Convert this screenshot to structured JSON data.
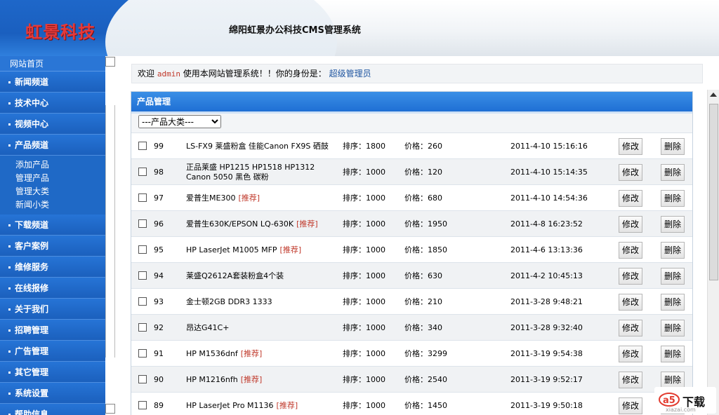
{
  "header": {
    "logo": "虹景科技",
    "system_title": "绵阳虹景办公科技CMS管理系统"
  },
  "sidebar": {
    "home": "网站首页",
    "items": [
      {
        "label": "新闻频道"
      },
      {
        "label": "技术中心"
      },
      {
        "label": "视频中心"
      },
      {
        "label": "产品频道",
        "sub": [
          "添加产品",
          "管理产品",
          "管理大类",
          "新闻小类"
        ]
      },
      {
        "label": "下载频道"
      },
      {
        "label": "客户案例"
      },
      {
        "label": "维修服务"
      },
      {
        "label": "在线报修"
      },
      {
        "label": "关于我们"
      },
      {
        "label": "招聘管理"
      },
      {
        "label": "广告管理"
      },
      {
        "label": "其它管理"
      },
      {
        "label": "系统设置"
      },
      {
        "label": "帮助信息"
      }
    ]
  },
  "welcome": {
    "prefix": "欢迎",
    "username": "admin",
    "middle": "使用本网站管理系统！！你的身份是：",
    "role": "超级管理员"
  },
  "panel": {
    "title": "产品管理",
    "filter_selected": "---产品大类---",
    "edit_label": "修改",
    "delete_label": "删除",
    "rows": [
      {
        "id": "99",
        "name": "LS-FX9 莱盛粉盒 佳能Canon FX9S 硒鼓",
        "tag": "",
        "sort": "排序：1800",
        "price": "价格：260",
        "date": "2011-4-10 15:16:16"
      },
      {
        "id": "98",
        "name": "正品莱盛 HP1215 HP1518 HP1312 Canon 5050 黑色 碳粉",
        "tag": "",
        "sort": "排序：1000",
        "price": "价格：120",
        "date": "2011-4-10 15:14:35"
      },
      {
        "id": "97",
        "name": "爱普生ME300",
        "tag": "[推荐]",
        "sort": "排序：1000",
        "price": "价格：680",
        "date": "2011-4-10 14:54:36"
      },
      {
        "id": "96",
        "name": "爱普生630K/EPSON LQ-630K",
        "tag": "[推荐]",
        "sort": "排序：1000",
        "price": "价格：1950",
        "date": "2011-4-8 16:23:52"
      },
      {
        "id": "95",
        "name": "HP LaserJet M1005 MFP",
        "tag": "[推荐]",
        "sort": "排序：1000",
        "price": "价格：1850",
        "date": "2011-4-6 13:13:36"
      },
      {
        "id": "94",
        "name": "莱盛Q2612A套装粉盒4个装",
        "tag": "",
        "sort": "排序：1000",
        "price": "价格：630",
        "date": "2011-4-2 10:45:13"
      },
      {
        "id": "93",
        "name": "金士顿2GB DDR3 1333",
        "tag": "",
        "sort": "排序：1000",
        "price": "价格：210",
        "date": "2011-3-28 9:48:21"
      },
      {
        "id": "92",
        "name": "昂达G41C+",
        "tag": "",
        "sort": "排序：1000",
        "price": "价格：340",
        "date": "2011-3-28 9:32:40"
      },
      {
        "id": "91",
        "name": "HP M1536dnf",
        "tag": "[推荐]",
        "sort": "排序：1000",
        "price": "价格：3299",
        "date": "2011-3-19 9:54:38"
      },
      {
        "id": "90",
        "name": "HP M1216nfh",
        "tag": "[推荐]",
        "sort": "排序：1000",
        "price": "价格：2540",
        "date": "2011-3-19 9:52:17"
      },
      {
        "id": "89",
        "name": "HP LaserJet Pro M1136",
        "tag": "[推荐]",
        "sort": "排序：1000",
        "price": "价格：1450",
        "date": "2011-3-19 9:50:18"
      }
    ]
  },
  "watermark": {
    "text": "下载",
    "sub": "xiazai.com"
  },
  "colors": {
    "sidebar_blue": "#1f69c6",
    "header_blue": "#1f6fd4",
    "tag_red": "#c0392b"
  }
}
